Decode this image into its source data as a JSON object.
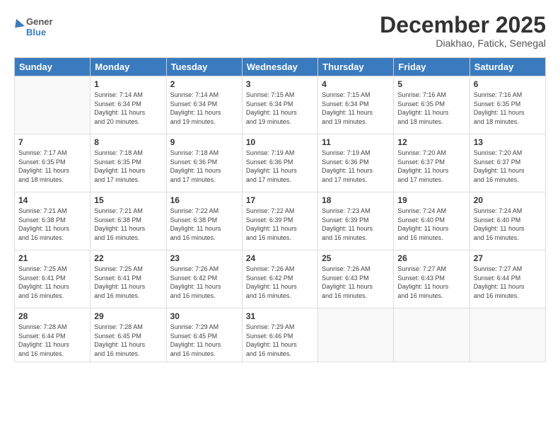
{
  "header": {
    "logo_general": "General",
    "logo_blue": "Blue",
    "month_title": "December 2025",
    "subtitle": "Diakhao, Fatick, Senegal"
  },
  "days_of_week": [
    "Sunday",
    "Monday",
    "Tuesday",
    "Wednesday",
    "Thursday",
    "Friday",
    "Saturday"
  ],
  "weeks": [
    [
      {
        "day": "",
        "info": ""
      },
      {
        "day": "1",
        "info": "Sunrise: 7:14 AM\nSunset: 6:34 PM\nDaylight: 11 hours\nand 20 minutes."
      },
      {
        "day": "2",
        "info": "Sunrise: 7:14 AM\nSunset: 6:34 PM\nDaylight: 11 hours\nand 19 minutes."
      },
      {
        "day": "3",
        "info": "Sunrise: 7:15 AM\nSunset: 6:34 PM\nDaylight: 11 hours\nand 19 minutes."
      },
      {
        "day": "4",
        "info": "Sunrise: 7:15 AM\nSunset: 6:34 PM\nDaylight: 11 hours\nand 19 minutes."
      },
      {
        "day": "5",
        "info": "Sunrise: 7:16 AM\nSunset: 6:35 PM\nDaylight: 11 hours\nand 18 minutes."
      },
      {
        "day": "6",
        "info": "Sunrise: 7:16 AM\nSunset: 6:35 PM\nDaylight: 11 hours\nand 18 minutes."
      }
    ],
    [
      {
        "day": "7",
        "info": "Sunrise: 7:17 AM\nSunset: 6:35 PM\nDaylight: 11 hours\nand 18 minutes."
      },
      {
        "day": "8",
        "info": "Sunrise: 7:18 AM\nSunset: 6:35 PM\nDaylight: 11 hours\nand 17 minutes."
      },
      {
        "day": "9",
        "info": "Sunrise: 7:18 AM\nSunset: 6:36 PM\nDaylight: 11 hours\nand 17 minutes."
      },
      {
        "day": "10",
        "info": "Sunrise: 7:19 AM\nSunset: 6:36 PM\nDaylight: 11 hours\nand 17 minutes."
      },
      {
        "day": "11",
        "info": "Sunrise: 7:19 AM\nSunset: 6:36 PM\nDaylight: 11 hours\nand 17 minutes."
      },
      {
        "day": "12",
        "info": "Sunrise: 7:20 AM\nSunset: 6:37 PM\nDaylight: 11 hours\nand 17 minutes."
      },
      {
        "day": "13",
        "info": "Sunrise: 7:20 AM\nSunset: 6:37 PM\nDaylight: 11 hours\nand 16 minutes."
      }
    ],
    [
      {
        "day": "14",
        "info": "Sunrise: 7:21 AM\nSunset: 6:38 PM\nDaylight: 11 hours\nand 16 minutes."
      },
      {
        "day": "15",
        "info": "Sunrise: 7:21 AM\nSunset: 6:38 PM\nDaylight: 11 hours\nand 16 minutes."
      },
      {
        "day": "16",
        "info": "Sunrise: 7:22 AM\nSunset: 6:38 PM\nDaylight: 11 hours\nand 16 minutes."
      },
      {
        "day": "17",
        "info": "Sunrise: 7:22 AM\nSunset: 6:39 PM\nDaylight: 11 hours\nand 16 minutes."
      },
      {
        "day": "18",
        "info": "Sunrise: 7:23 AM\nSunset: 6:39 PM\nDaylight: 11 hours\nand 16 minutes."
      },
      {
        "day": "19",
        "info": "Sunrise: 7:24 AM\nSunset: 6:40 PM\nDaylight: 11 hours\nand 16 minutes."
      },
      {
        "day": "20",
        "info": "Sunrise: 7:24 AM\nSunset: 6:40 PM\nDaylight: 11 hours\nand 16 minutes."
      }
    ],
    [
      {
        "day": "21",
        "info": "Sunrise: 7:25 AM\nSunset: 6:41 PM\nDaylight: 11 hours\nand 16 minutes."
      },
      {
        "day": "22",
        "info": "Sunrise: 7:25 AM\nSunset: 6:41 PM\nDaylight: 11 hours\nand 16 minutes."
      },
      {
        "day": "23",
        "info": "Sunrise: 7:26 AM\nSunset: 6:42 PM\nDaylight: 11 hours\nand 16 minutes."
      },
      {
        "day": "24",
        "info": "Sunrise: 7:26 AM\nSunset: 6:42 PM\nDaylight: 11 hours\nand 16 minutes."
      },
      {
        "day": "25",
        "info": "Sunrise: 7:26 AM\nSunset: 6:43 PM\nDaylight: 11 hours\nand 16 minutes."
      },
      {
        "day": "26",
        "info": "Sunrise: 7:27 AM\nSunset: 6:43 PM\nDaylight: 11 hours\nand 16 minutes."
      },
      {
        "day": "27",
        "info": "Sunrise: 7:27 AM\nSunset: 6:44 PM\nDaylight: 11 hours\nand 16 minutes."
      }
    ],
    [
      {
        "day": "28",
        "info": "Sunrise: 7:28 AM\nSunset: 6:44 PM\nDaylight: 11 hours\nand 16 minutes."
      },
      {
        "day": "29",
        "info": "Sunrise: 7:28 AM\nSunset: 6:45 PM\nDaylight: 11 hours\nand 16 minutes."
      },
      {
        "day": "30",
        "info": "Sunrise: 7:29 AM\nSunset: 6:45 PM\nDaylight: 11 hours\nand 16 minutes."
      },
      {
        "day": "31",
        "info": "Sunrise: 7:29 AM\nSunset: 6:46 PM\nDaylight: 11 hours\nand 16 minutes."
      },
      {
        "day": "",
        "info": ""
      },
      {
        "day": "",
        "info": ""
      },
      {
        "day": "",
        "info": ""
      }
    ]
  ]
}
